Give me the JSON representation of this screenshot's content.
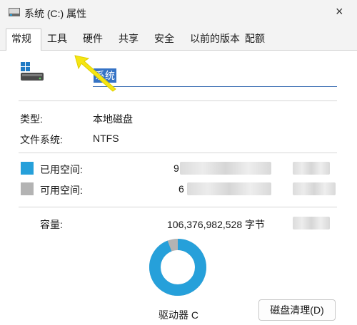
{
  "window": {
    "title": "系统 (C:) 属性",
    "close_glyph": "×"
  },
  "tabs": [
    {
      "label": "常规",
      "active": true
    },
    {
      "label": "工具"
    },
    {
      "label": "硬件"
    },
    {
      "label": "共享"
    },
    {
      "label": "安全"
    },
    {
      "label": "以前的版本"
    },
    {
      "label": "配额"
    }
  ],
  "general": {
    "drive_name": "系统",
    "type_label": "类型:",
    "type_value": "本地磁盘",
    "fs_label": "文件系统:",
    "fs_value": "NTFS",
    "used_label": "已用空间:",
    "used_value_prefix": "9",
    "free_label": "可用空间:",
    "free_value_prefix": "6",
    "capacity_label": "容量:",
    "capacity_value": "106,376,982,528 字节",
    "drive_label": "驱动器 C",
    "cleanup_button": "磁盘清理(D)",
    "used_fraction": 0.94
  },
  "colors": {
    "used": "#26a0da",
    "free": "#b3b3b3",
    "accent": "#3573c5",
    "annotation_arrow": "#f5e512"
  }
}
